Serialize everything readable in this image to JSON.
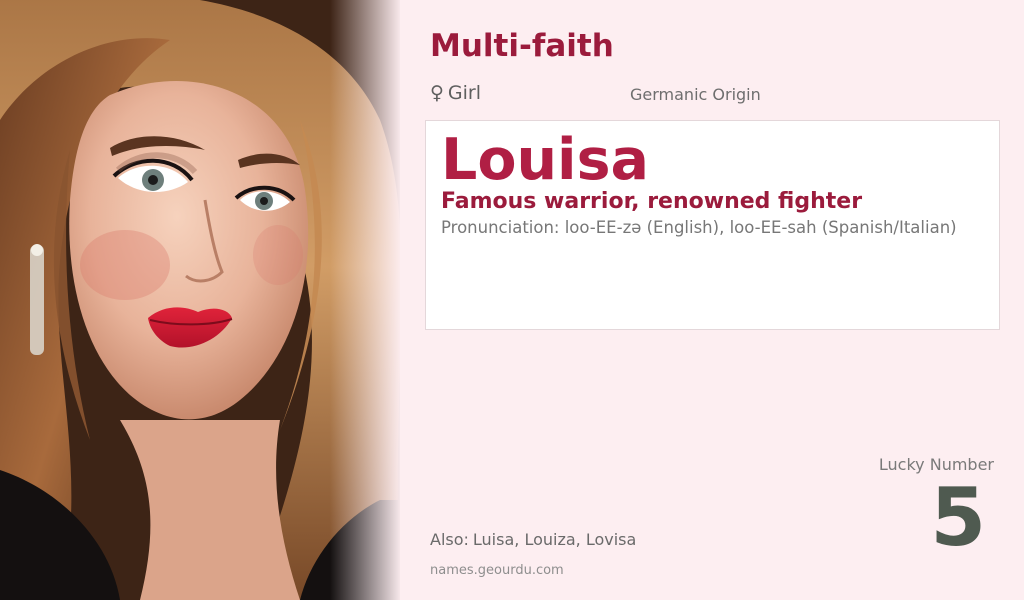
{
  "card": {
    "category": "Multi-faith",
    "gender": {
      "symbol": "♀",
      "label": "Girl"
    },
    "origin": "Germanic Origin",
    "name": "Louisa",
    "meaning": "Famous warrior, renowned fighter",
    "pronunciation": "Pronunciation: loo-EE-zə (English), loo-EE-sah (Spanish/Italian)",
    "lucky": {
      "label": "Lucky Number",
      "value": "5"
    },
    "also": {
      "label": "Also:",
      "names": "Luisa, Louiza, Lovisa"
    },
    "source": "names.geourdu.com"
  },
  "colors": {
    "accent": "#9b1b3c",
    "name": "#b01f44",
    "panel_background": "#fdeef1",
    "lucky_number": "#4f5a50"
  },
  "portrait": {
    "subject": "woman with long wavy auburn hair and red lipstick",
    "icon": "portrait-photo"
  }
}
